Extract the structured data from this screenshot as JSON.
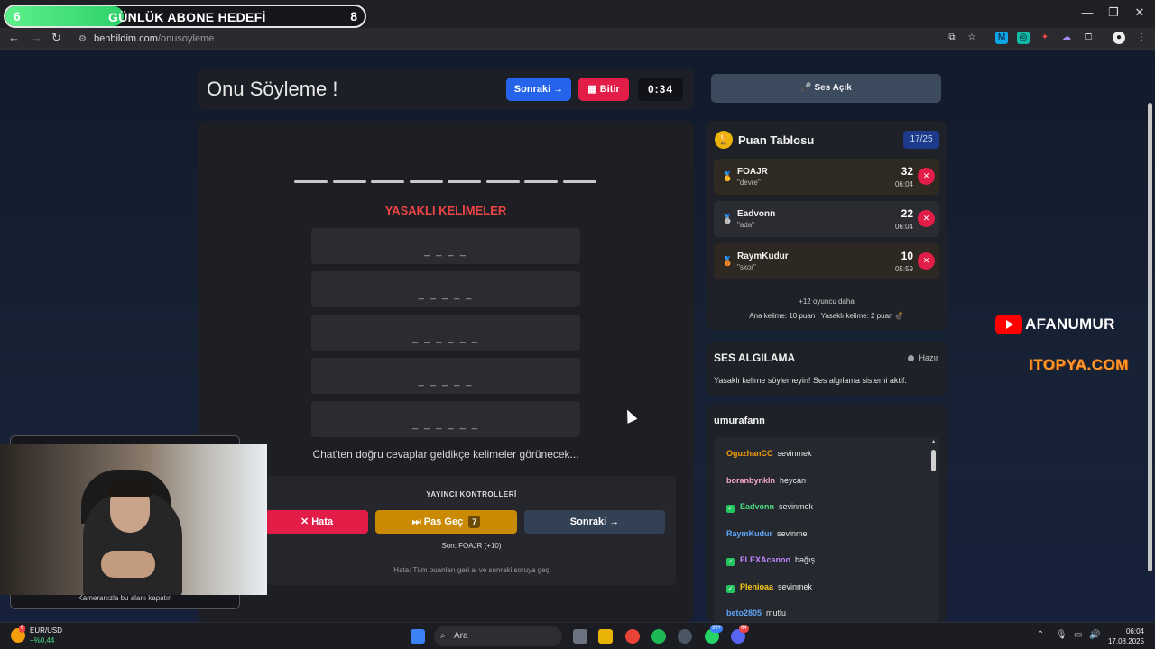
{
  "goal": {
    "start": "6",
    "label": "GÜNLÜK ABONE HEDEFİ",
    "end": "8",
    "progress": 0.33
  },
  "window_controls": {
    "minimize": "—",
    "maximize": "❐",
    "close": "✕"
  },
  "browser": {
    "back": "←",
    "forward": "→",
    "reload": "↻",
    "url_host": "benbildim.com",
    "url_path": "/onusoyleme"
  },
  "header": {
    "title": "Onu Söyleme !",
    "next_label": "Sonraki →",
    "finish_label": "Bitir",
    "timer": "0:34"
  },
  "game": {
    "letter_count": 8,
    "forbidden_title": "YASAKLI KELİMELER",
    "forbidden_words": [
      "_ _ _ _",
      "_ _ _ _ _",
      "_ _ _ _ _ _",
      "_ _ _ _ _",
      "_ _ _ _ _ _"
    ],
    "chat_hint": "Chat'ten doğru cevaplar geldikçe kelimeler görünecek..."
  },
  "controls": {
    "title": "YAYINCI KONTROLLERİ",
    "error_label": "Hata",
    "pass_label": "Pas Geç",
    "pass_count": "7",
    "next_label": "Sonraki →",
    "last": "Son: FOAJR (+10)",
    "help": "Hata: Tüm puanları geri al ve sonraki soruya geç"
  },
  "sound_button": "Ses Açık",
  "scoreboard": {
    "title": "Puan Tablosu",
    "round": "17/25",
    "rows": [
      {
        "name": "FOAJR",
        "word": "\"devre\"",
        "points": "32",
        "time": "06:04",
        "medal": "🥇"
      },
      {
        "name": "Eadvonn",
        "word": "\"ada\"",
        "points": "22",
        "time": "06:04",
        "medal": "🥈"
      },
      {
        "name": "RaymKudur",
        "word": "\"skor\"",
        "points": "10",
        "time": "05:59",
        "medal": "🥉"
      }
    ],
    "more": "+12 oyuncu daha",
    "rule": "Ana kelime: 10 puan | Yasaklı kelime: 2 puan 💣"
  },
  "sound_detect": {
    "title": "SES ALGILAMA",
    "status": "Hazır",
    "desc": "Yasaklı kelime söylemeyin! Ses algılama sistemi aktif."
  },
  "chat": {
    "title": "umurafann",
    "messages": [
      {
        "user": "OguzhanCC",
        "text": "sevinmek",
        "color": "#f59e0b",
        "check": false
      },
      {
        "user": "boranbynkln",
        "text": "heycan",
        "color": "#f9a8d4",
        "check": false
      },
      {
        "user": "Eadvonn",
        "text": "sevinmek",
        "color": "#4ade80",
        "check": true
      },
      {
        "user": "RaymKudur",
        "text": "sevinme",
        "color": "#60a5fa",
        "check": false
      },
      {
        "user": "FLEXAcanoo",
        "text": "bağış",
        "color": "#c084fc",
        "check": true
      },
      {
        "user": "Plenioaa",
        "text": "sevinmek",
        "color": "#facc15",
        "check": true
      },
      {
        "user": "beto2805",
        "text": "mutlu",
        "color": "#60a5fa",
        "check": false
      }
    ]
  },
  "brand": {
    "name": "AFANUMUR",
    "site": "ITOPYA.COM"
  },
  "webcam": {
    "caption": "Kameranızla bu alanı kapatın"
  },
  "taskbar": {
    "fx_name": "EUR/USD",
    "fx_value": "+%0,44",
    "fx_badge": "6",
    "search": "Ara",
    "whatsapp_badge": "99+",
    "discord_badge": "64",
    "time": "06:04",
    "date": "17.08.2025"
  }
}
